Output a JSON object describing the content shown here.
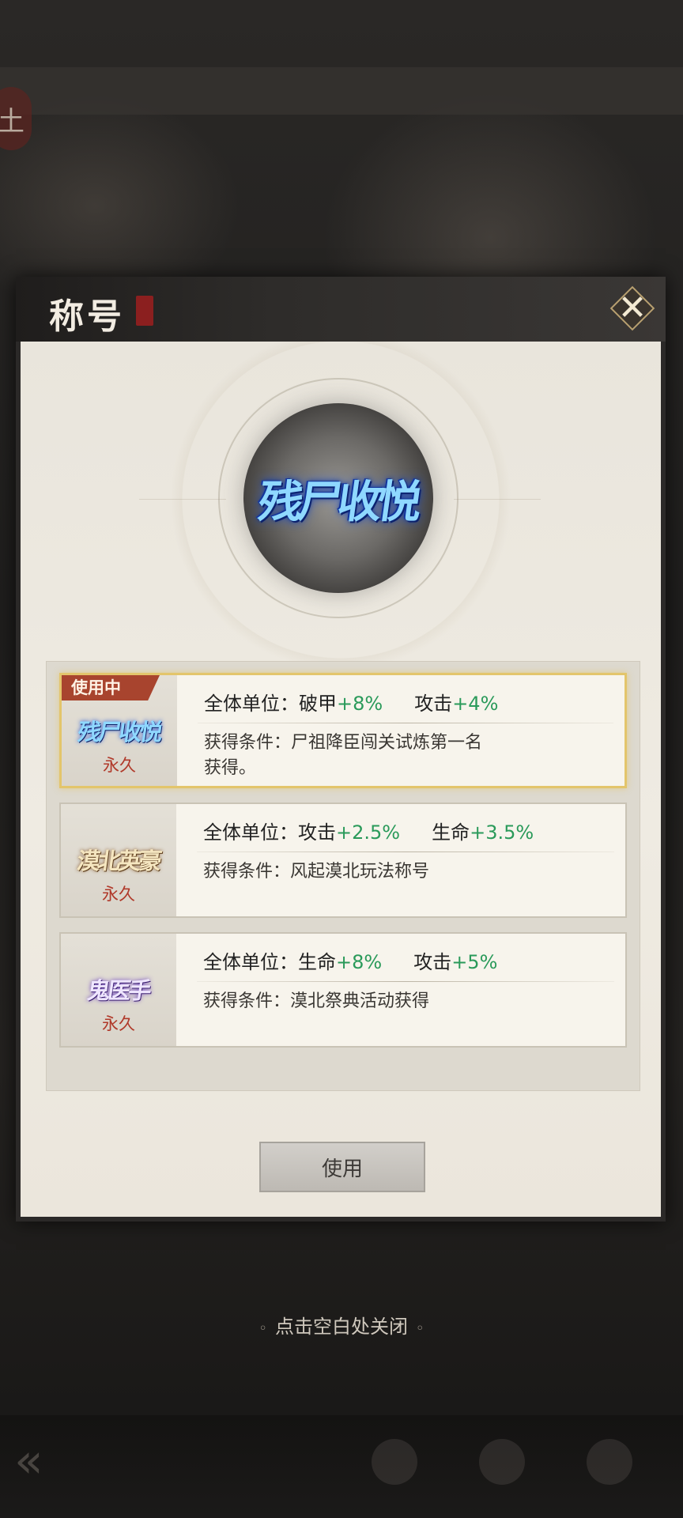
{
  "dialog": {
    "title": "称号",
    "title_seal": "称号",
    "close_icon": "close-icon",
    "featured_title_art": "残尸收悦",
    "use_button_label": "使用"
  },
  "titles": [
    {
      "badge": "使用中",
      "art": "残尸收悦",
      "duration": "永久",
      "stat_prefix": "全体单位：",
      "stat1_name": "破甲",
      "stat1_value": "+8%",
      "stat2_name": "攻击",
      "stat2_value": "+4%",
      "condition_label": "获得条件：",
      "condition_text": "尸祖降臣闯关试炼第一名",
      "condition_text_2": "获得。",
      "selected": true
    },
    {
      "art": "漠北英豪",
      "duration": "永久",
      "stat_prefix": "全体单位：",
      "stat1_name": "攻击",
      "stat1_value": "+2.5%",
      "stat2_name": "生命",
      "stat2_value": "+3.5%",
      "condition_label": "获得条件：",
      "condition_text": "风起漠北玩法称号",
      "selected": false
    },
    {
      "art": "鬼医手",
      "duration": "永久",
      "stat_prefix": "全体单位：",
      "stat1_name": "生命",
      "stat1_value": "+8%",
      "stat2_name": "攻击",
      "stat2_value": "+5%",
      "condition_label": "获得条件：",
      "condition_text": "漠北祭典活动获得",
      "selected": false
    }
  ],
  "footer": {
    "hint": "点击空白处关闭"
  },
  "colors": {
    "stat_positive": "#2a9a5a",
    "duration": "#b0392a",
    "selected_border": "#e3c56b",
    "badge_bg": "#a8442e"
  }
}
